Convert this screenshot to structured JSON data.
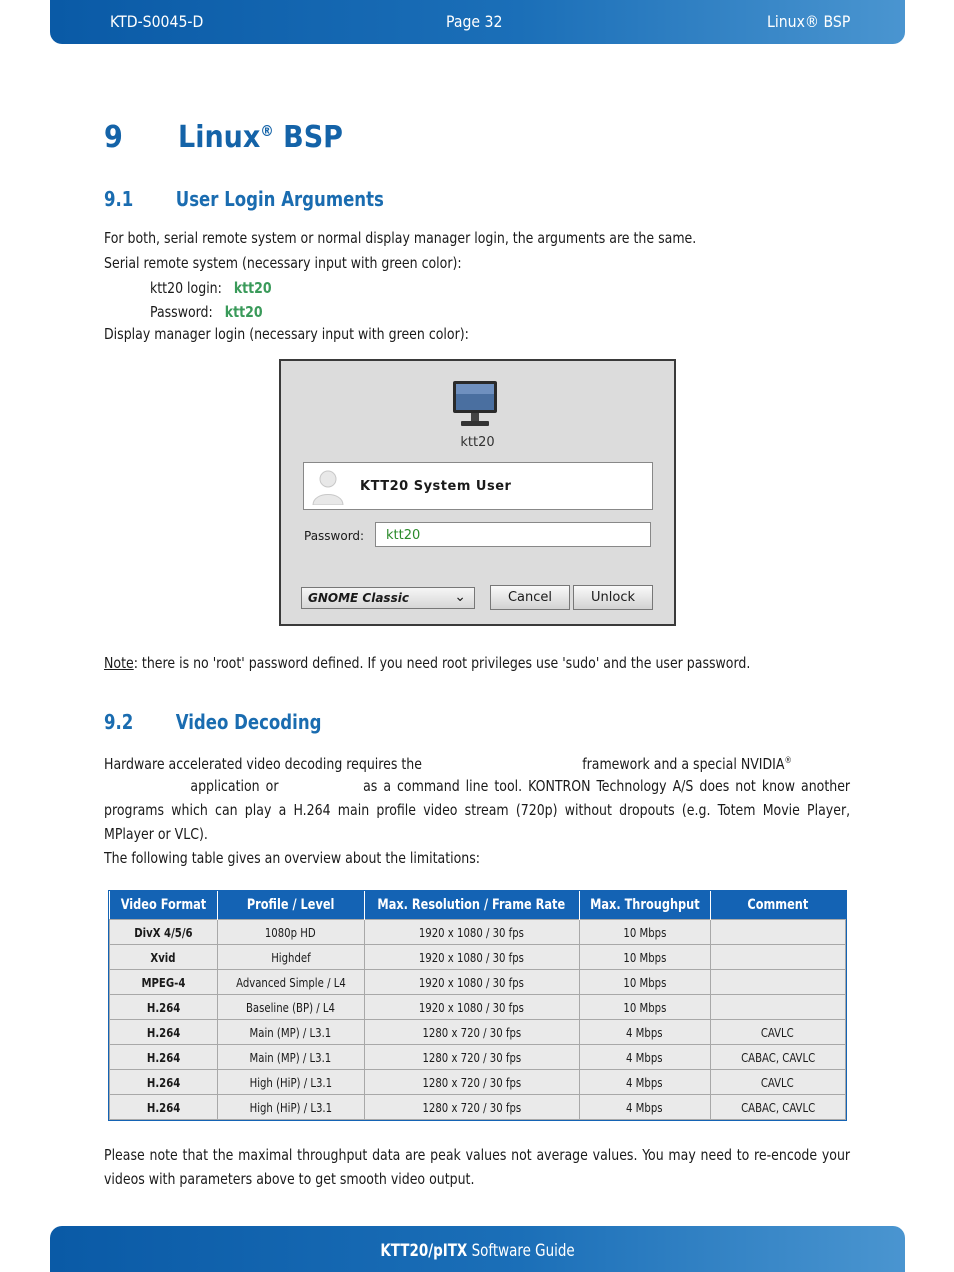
{
  "header": {
    "doc_id": "KTD-S0045-D",
    "page": "Page 32",
    "section": "Linux® BSP"
  },
  "chapter": {
    "number": "9",
    "title_main": "Linux",
    "title_reg": "®",
    "title_rest": " BSP"
  },
  "section_1": {
    "number": "9.1",
    "title": "User Login Arguments",
    "intro": "For both, serial remote system or normal display manager login, the arguments are the same.",
    "serial_intro": "Serial remote system (necessary input with green color):",
    "login_label": "ktt20 login:",
    "login_value": "ktt20",
    "password_label": "Password:",
    "password_value": "ktt20",
    "display_intro": "Display manager login (necessary input with green color):"
  },
  "login_dialog": {
    "hostname": "ktt20",
    "user_name": "KTT20 System User",
    "password_label": "Password:",
    "password_value": "ktt20",
    "session": "GNOME Classic",
    "cancel_label": "Cancel",
    "unlock_label": "Unlock"
  },
  "note": {
    "label": "Note",
    "text": ": there is no 'root' password defined. If you need root privileges use 'sudo' and the user password."
  },
  "section_2": {
    "number": "9.2",
    "title": "Video Decoding",
    "para1_a": "Hardware accelerated video decoding requires the",
    "para1_b": "framework and a special NVIDIA",
    "para1_reg": "®",
    "para1_c": "application or",
    "para1_d": "as a command line tool. KONTRON Technology A/S does not know another programs which can play a H.264 main profile video stream (720p) without dropouts (e.g. Totem Movie Player, MPlayer or VLC).",
    "para2": "The following table gives an overview about the limitations:"
  },
  "table": {
    "headers": [
      "Video Format",
      "Profile / Level",
      "Max. Resolution / Frame Rate",
      "Max. Throughput",
      "Comment"
    ],
    "rows": [
      [
        "DivX 4/5/6",
        "1080p HD",
        "1920 x 1080 / 30 fps",
        "10 Mbps",
        ""
      ],
      [
        "Xvid",
        "Highdef",
        "1920 x 1080 / 30 fps",
        "10 Mbps",
        ""
      ],
      [
        "MPEG-4",
        "Advanced Simple / L4",
        "1920 x 1080 / 30 fps",
        "10 Mbps",
        ""
      ],
      [
        "H.264",
        "Baseline (BP) / L4",
        "1920 x 1080 / 30 fps",
        "10 Mbps",
        ""
      ],
      [
        "H.264",
        "Main (MP) / L3.1",
        "1280 x 720 / 30 fps",
        "4 Mbps",
        "CAVLC"
      ],
      [
        "H.264",
        "Main (MP) / L3.1",
        "1280 x 720 / 30 fps",
        "4 Mbps",
        "CABAC, CAVLC"
      ],
      [
        "H.264",
        "High (HiP) / L3.1",
        "1280 x 720 / 30 fps",
        "4 Mbps",
        "CAVLC"
      ],
      [
        "H.264",
        "High (HiP) / L3.1",
        "1280 x 720 / 30 fps",
        "4 Mbps",
        "CABAC, CAVLC"
      ]
    ]
  },
  "closing": "Please note that the maximal throughput data are peak values not average values. You may need to re-encode your videos with parameters above to get smooth video output.",
  "footer": {
    "product": "KTT20/pITX",
    "guide": " Software Guide"
  }
}
